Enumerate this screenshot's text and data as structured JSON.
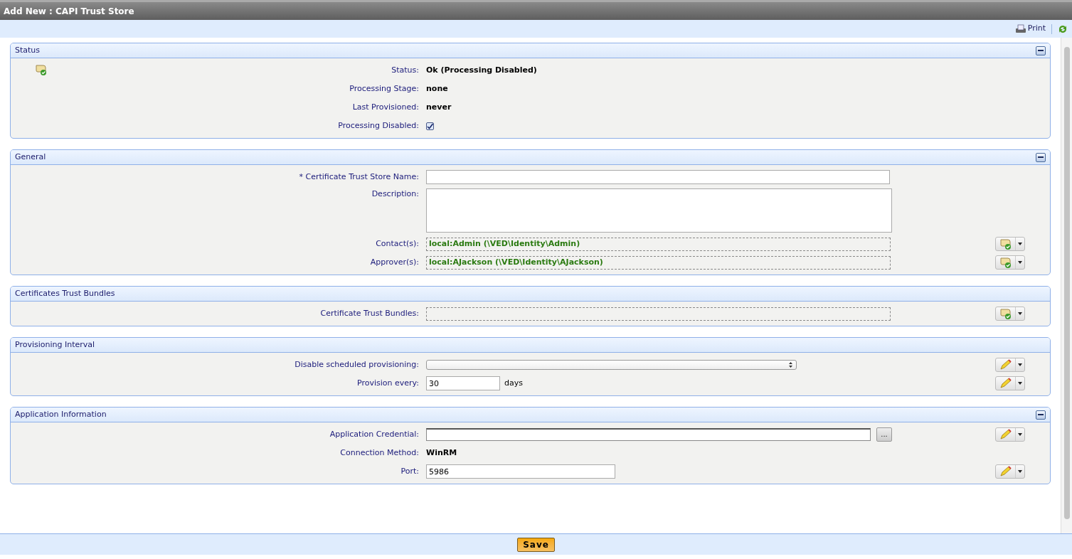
{
  "window": {
    "title": "Add New : CAPI Trust Store"
  },
  "toolbar": {
    "print": "Print"
  },
  "sections": [
    {
      "title": "Status",
      "collapsible": true,
      "status_icon": true,
      "rows": [
        {
          "kind": "text",
          "label": "Status:",
          "value": "Ok (Processing Disabled)"
        },
        {
          "kind": "text",
          "label": "Processing Stage:",
          "value": "none"
        },
        {
          "kind": "text",
          "label": "Last Provisioned:",
          "value": "never"
        },
        {
          "kind": "checkbox",
          "label": "Processing Disabled:",
          "checked": true
        }
      ]
    },
    {
      "title": "General",
      "collapsible": true,
      "status_icon": false,
      "rows": [
        {
          "kind": "wideinput",
          "label": "* Certificate Trust Store Name:",
          "value": ""
        },
        {
          "kind": "textarea",
          "label": "Description:",
          "value": ""
        },
        {
          "kind": "list",
          "label": "Contact(s):",
          "value": "local:Admin (\\VED\\Identity\\Admin)",
          "button": {
            "kind": "picker"
          }
        },
        {
          "kind": "list",
          "label": "Approver(s):",
          "value": "local:AJackson (\\VED\\Identity\\AJackson)",
          "button": {
            "kind": "picker"
          }
        }
      ]
    },
    {
      "title": "Certificates Trust Bundles",
      "collapsible": false,
      "status_icon": false,
      "rows": [
        {
          "kind": "list",
          "label": "Certificate Trust Bundles:",
          "value": "",
          "button": {
            "kind": "picker"
          }
        }
      ]
    },
    {
      "title": "Provisioning Interval",
      "collapsible": false,
      "status_icon": false,
      "rows": [
        {
          "kind": "select",
          "label": "Disable scheduled provisioning:",
          "value": "",
          "button": {
            "kind": "edit"
          }
        },
        {
          "kind": "shortinput",
          "label": "Provision every:",
          "value": "30",
          "suffix": "days",
          "button": {
            "kind": "edit"
          }
        }
      ]
    },
    {
      "title": "Application Information",
      "collapsible": true,
      "status_icon": false,
      "rows": [
        {
          "kind": "browse",
          "label": "Application Credential:",
          "value": "",
          "browse": "...",
          "button": {
            "kind": "edit"
          }
        },
        {
          "kind": "text",
          "label": "Connection Method:",
          "value": "WinRM"
        },
        {
          "kind": "mediuminput",
          "label": "Port:",
          "value": "5986",
          "button": {
            "kind": "edit"
          }
        }
      ]
    }
  ],
  "footer": {
    "save": "Save"
  }
}
